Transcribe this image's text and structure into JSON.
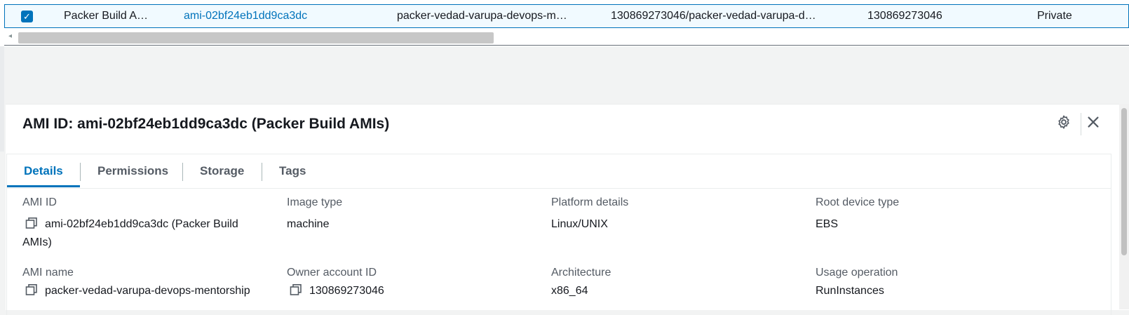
{
  "table_row": {
    "selected": true,
    "name": "Packer Build A…",
    "ami_id": "ami-02bf24eb1dd9ca3dc",
    "ami_name": "packer-vedad-varupa-devops-m…",
    "source": "130869273046/packer-vedad-varupa-d…",
    "owner": "130869273046",
    "visibility": "Private"
  },
  "panel": {
    "title": "AMI ID: ami-02bf24eb1dd9ca3dc (Packer Build AMIs)",
    "drag_handle": "=",
    "settings_icon": "gear-icon",
    "close_icon": "close-icon"
  },
  "tabs": [
    {
      "label": "Details",
      "active": true
    },
    {
      "label": "Permissions",
      "active": false
    },
    {
      "label": "Storage",
      "active": false
    },
    {
      "label": "Tags",
      "active": false
    }
  ],
  "details": {
    "ami_id": {
      "label": "AMI ID",
      "value": "ami-02bf24eb1dd9ca3dc (Packer Build AMIs)"
    },
    "image_type": {
      "label": "Image type",
      "value": "machine"
    },
    "platform_details": {
      "label": "Platform details",
      "value": "Linux/UNIX"
    },
    "root_device_type": {
      "label": "Root device type",
      "value": "EBS"
    },
    "ami_name": {
      "label": "AMI name",
      "value": "packer-vedad-varupa-devops-mentorship"
    },
    "owner_account_id": {
      "label": "Owner account ID",
      "value": "130869273046"
    },
    "architecture": {
      "label": "Architecture",
      "value": "x86_64"
    },
    "usage_operation": {
      "label": "Usage operation",
      "value": "RunInstances"
    }
  },
  "colors": {
    "accent": "#0073bb",
    "selected_row_bg": "#f1faff"
  }
}
